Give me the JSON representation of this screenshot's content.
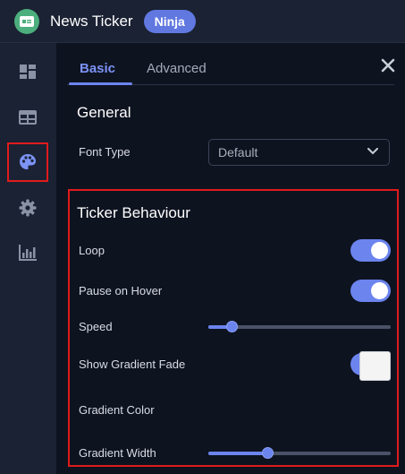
{
  "app": {
    "title": "News Ticker",
    "badge": "Ninja"
  },
  "sidebar": {
    "items": [
      {
        "icon": "dashboard-icon"
      },
      {
        "icon": "table-icon"
      },
      {
        "icon": "palette-icon",
        "active": true
      },
      {
        "icon": "gear-icon"
      },
      {
        "icon": "bar-chart-icon"
      }
    ]
  },
  "tabs": [
    {
      "label": "Basic",
      "active": true
    },
    {
      "label": "Advanced",
      "active": false
    }
  ],
  "general": {
    "title": "General",
    "font_type_label": "Font Type",
    "font_type_value": "Default"
  },
  "behaviour": {
    "title": "Ticker Behaviour",
    "loop_label": "Loop",
    "loop_on": true,
    "pause_label": "Pause on Hover",
    "pause_on": true,
    "speed_label": "Speed",
    "speed_fraction": 0.13,
    "fade_label": "Show Gradient Fade",
    "fade_on": true,
    "gradient_color_label": "Gradient Color",
    "gradient_color": "#f4f4f4",
    "gradient_width_label": "Gradient Width",
    "gradient_width_fraction": 0.33
  },
  "colors": {
    "accent": "#6b84ee",
    "highlight": "#e01b1b"
  }
}
